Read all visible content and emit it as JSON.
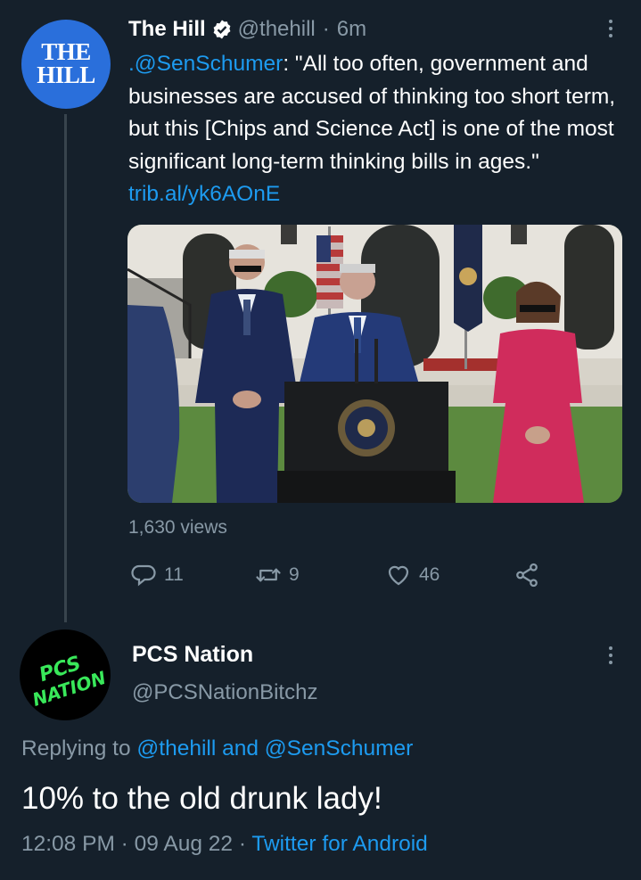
{
  "tweet": {
    "avatar_text_line1": "THE",
    "avatar_text_line2": "HILL",
    "author_name": "The Hill",
    "author_handle": "@thehill",
    "separator": "·",
    "time": "6m",
    "mention": ".@SenSchumer",
    "body": ": \"All too often, government and businesses are accused of thinking too short term, but this [Chips and Science Act] is one of the most significant long-term thinking bills in ages.\" ",
    "link": "trib.al/yk6AOnE",
    "views": "1,630 views",
    "replies_count": "11",
    "retweets_count": "9",
    "likes_count": "46"
  },
  "reply": {
    "avatar_text_line1": "PCS",
    "avatar_text_line2": "NATION",
    "author_name": "PCS Nation",
    "author_handle": "@PCSNationBitchz",
    "replying_prefix": "Replying to ",
    "replying_to_1": "@thehill",
    "replying_and": " and ",
    "replying_to_2": "@SenSchumer",
    "body": "10% to the old drunk lady!",
    "time": "12:08 PM",
    "separator": " · ",
    "date": "09 Aug 22",
    "source": "Twitter for Android"
  },
  "colors": {
    "background": "#15202b",
    "link": "#1d9bf0",
    "muted": "#8899a6",
    "hill_blue": "#2a6fdb",
    "pcs_green": "#39e85a"
  }
}
